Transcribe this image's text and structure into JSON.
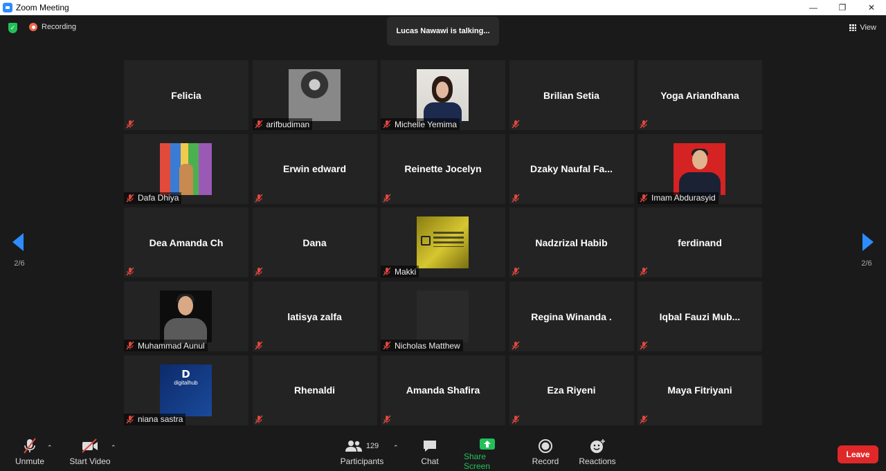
{
  "window": {
    "title": "Zoom Meeting",
    "minimize": "—",
    "restore": "❐",
    "close": "✕"
  },
  "top_bar": {
    "recording_label": "Recording",
    "talking_text": "Lucas Nawawi is talking...",
    "view_label": "View"
  },
  "pagination": {
    "left": "2/6",
    "right": "2/6"
  },
  "participants": [
    {
      "name": "Felicia",
      "has_video": false
    },
    {
      "name": "arifbudiman",
      "has_video": true,
      "thumb": "bw-portrait"
    },
    {
      "name": "Michelle Yemima",
      "has_video": true,
      "thumb": "woman-portrait"
    },
    {
      "name": "Brilian Setia",
      "has_video": false
    },
    {
      "name": "Yoga Ariandhana",
      "has_video": false
    },
    {
      "name": "Dafa Dhiya",
      "has_video": true,
      "thumb": "colorful-street"
    },
    {
      "name": "Erwin edward",
      "has_video": false
    },
    {
      "name": "Reinette Jocelyn",
      "has_video": false
    },
    {
      "name": "Dzaky  Naufal  Fa...",
      "has_video": false
    },
    {
      "name": "Imam Abdurasyid",
      "has_video": true,
      "thumb": "red-portrait"
    },
    {
      "name": "Dea Amanda Ch",
      "has_video": false
    },
    {
      "name": "Dana",
      "has_video": false
    },
    {
      "name": "Makki",
      "has_video": true,
      "thumb": "gold-wall"
    },
    {
      "name": "Nadzrizal Habib",
      "has_video": false
    },
    {
      "name": "ferdinand",
      "has_video": false
    },
    {
      "name": "Muhammad Aunul",
      "has_video": true,
      "thumb": "dark-portrait"
    },
    {
      "name": "latisya zalfa",
      "has_video": false
    },
    {
      "name": "Nicholas Matthew",
      "has_video": true,
      "thumb": "grey-blank"
    },
    {
      "name": "Regina Winanda .",
      "has_video": false
    },
    {
      "name": "Iqbal  Fauzi  Mub...",
      "has_video": false
    },
    {
      "name": "niana sastra",
      "has_video": true,
      "thumb": "digitalhub-logo",
      "thumb_text": {
        "letter": "D",
        "brand": "digitalhub"
      }
    },
    {
      "name": "Rhenaldi",
      "has_video": false
    },
    {
      "name": "Amanda Shafira",
      "has_video": false
    },
    {
      "name": "Eza Riyeni",
      "has_video": false
    },
    {
      "name": "Maya Fitriyani",
      "has_video": false
    }
  ],
  "toolbar": {
    "unmute": "Unmute",
    "start_video": "Start Video",
    "participants": "Participants",
    "participants_count": "129",
    "chat": "Chat",
    "share_screen": "Share Screen",
    "record": "Record",
    "reactions": "Reactions",
    "leave": "Leave"
  },
  "colors": {
    "accent": "#2d8cff",
    "mute_red": "#e0483e",
    "share_green": "#23c05a",
    "leave_red": "#e02828"
  }
}
